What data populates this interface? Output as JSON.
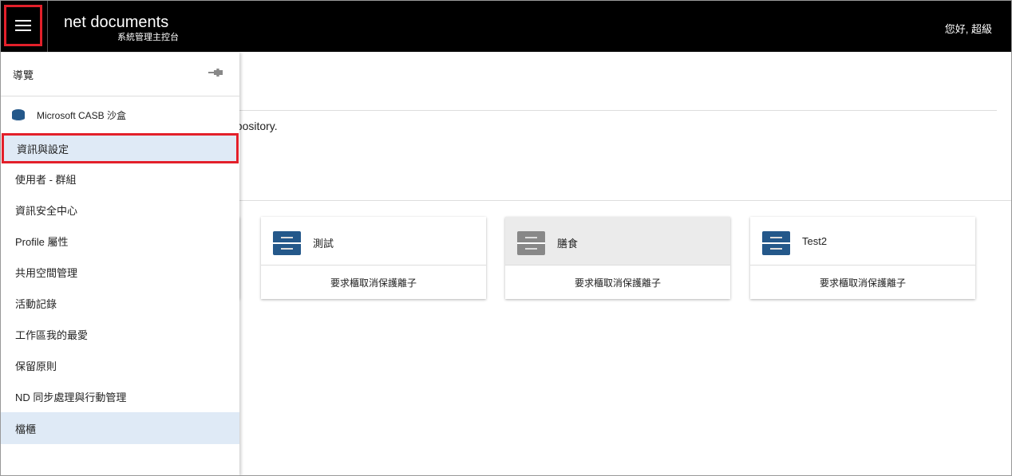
{
  "header": {
    "brand": "net documents",
    "subtitle": "系統管理主控台",
    "greeting": "您好, 超級",
    "menu_icon": "hamburger-icon"
  },
  "main": {
    "description": "epository.",
    "cards": [
      {
        "name": "測試",
        "action": "要求櫃取消保護離子",
        "icon": "cabinet-icon",
        "color": "#24588a"
      },
      {
        "name": "膳食",
        "action": "要求櫃取消保護離子",
        "icon": "cabinet-icon",
        "color": "#888888"
      },
      {
        "name": "Test2",
        "action": "要求櫃取消保護離子",
        "icon": "cabinet-icon",
        "color": "#24588a"
      }
    ]
  },
  "nav": {
    "title": "導覽",
    "repository": "Microsoft CASB 沙盒",
    "items": [
      {
        "label": "資訊與設定"
      },
      {
        "label": "使用者 - 群組"
      },
      {
        "label": "資訊安全中心"
      },
      {
        "label": "Profile 屬性"
      },
      {
        "label": "共用空間管理"
      },
      {
        "label": "活動記錄"
      },
      {
        "label": "工作區我的最愛"
      },
      {
        "label": "保留原則"
      },
      {
        "label": "ND 同步處理與行動管理"
      },
      {
        "label": "檔櫃"
      }
    ]
  },
  "colors": {
    "accent": "#24588a",
    "highlight": "#e3202a",
    "selected_bg": "#dfeaf6"
  }
}
